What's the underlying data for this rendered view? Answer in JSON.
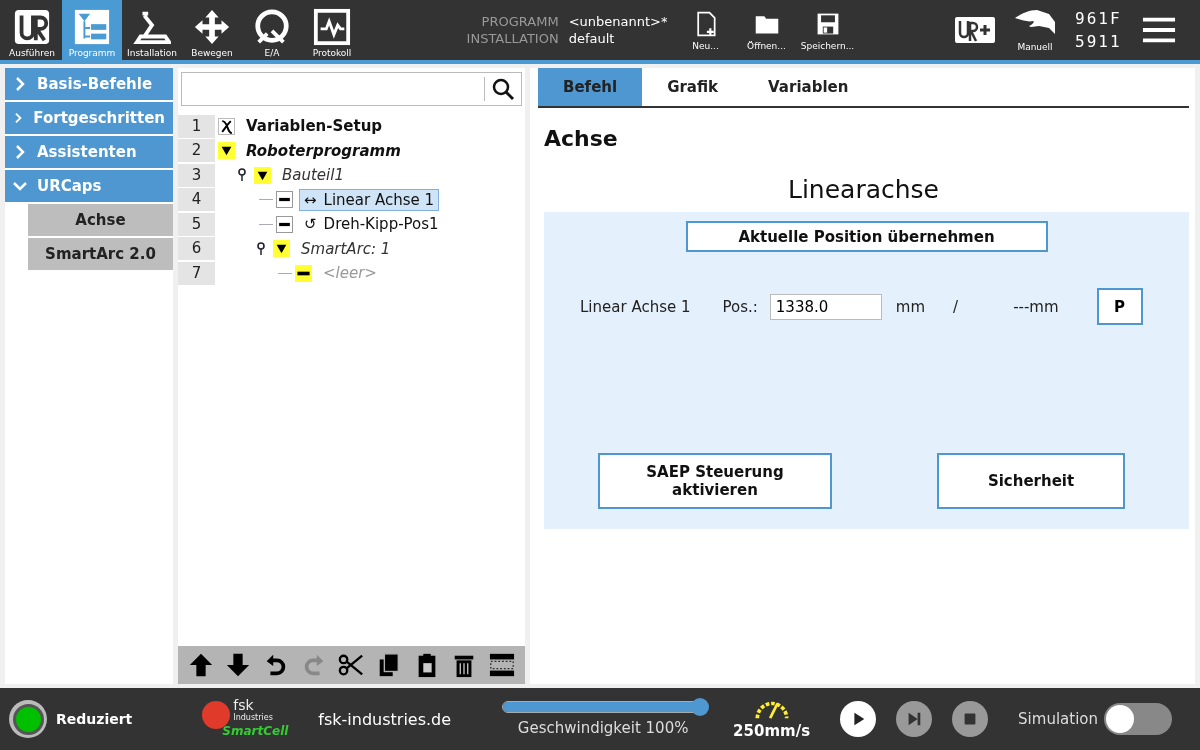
{
  "top_bar": {
    "nav": [
      {
        "kind": "run",
        "label": "Ausführen",
        "selected": false
      },
      {
        "kind": "program",
        "label": "Programm",
        "selected": true
      },
      {
        "kind": "installation",
        "label": "Installation",
        "selected": false
      },
      {
        "kind": "move",
        "label": "Bewegen",
        "selected": false
      },
      {
        "kind": "io",
        "label": "E/A",
        "selected": false
      },
      {
        "kind": "log",
        "label": "Protokoll",
        "selected": false
      }
    ],
    "program_label": "PROGRAMM",
    "program_value": "<unbenannt>*",
    "installation_label": "INSTALLATION",
    "installation_value": "default",
    "file_buttons": [
      {
        "kind": "new",
        "label": "Neu..."
      },
      {
        "kind": "open",
        "label": "Öffnen..."
      },
      {
        "kind": "save",
        "label": "Speichern..."
      }
    ],
    "mode": "Manuell",
    "serial": [
      "961F",
      "5911"
    ]
  },
  "sidebar": {
    "items": [
      {
        "label": "Basis-Befehle",
        "expanded": false
      },
      {
        "label": "Fortgeschritten",
        "expanded": false
      },
      {
        "label": "Assistenten",
        "expanded": false
      },
      {
        "label": "URCaps",
        "expanded": true,
        "children": [
          {
            "label": "Achse"
          },
          {
            "label": "SmartArc 2.0"
          }
        ]
      }
    ]
  },
  "tree": {
    "nodes": [
      {
        "line": "1",
        "kind": "variables",
        "label": "Variablen-Setup",
        "selected": false
      },
      {
        "line": "2",
        "kind": "folder",
        "label": "Roboterprogramm",
        "selected": false,
        "children": [
          {
            "line": "3",
            "kind": "folder",
            "label": "Bauteil1",
            "selected": false,
            "children": [
              {
                "line": "4",
                "kind": "command",
                "symbol": "↔",
                "label": "Linear Achse 1",
                "selected": true
              },
              {
                "line": "5",
                "kind": "command",
                "symbol": "↺",
                "label": "Dreh-Kipp-Pos1",
                "selected": false
              },
              {
                "line": "6",
                "kind": "folder",
                "label": "SmartArc: 1",
                "selected": false,
                "children": [
                  {
                    "line": "7",
                    "kind": "empty",
                    "label": "<leer>",
                    "selected": false
                  }
                ]
              }
            ]
          }
        ]
      }
    ],
    "toolbar": [
      {
        "kind": "up",
        "disabled": false
      },
      {
        "kind": "down",
        "disabled": false
      },
      {
        "kind": "undo",
        "disabled": false
      },
      {
        "kind": "redo",
        "disabled": true
      },
      {
        "kind": "cut",
        "disabled": false
      },
      {
        "kind": "copy",
        "disabled": false
      },
      {
        "kind": "paste",
        "disabled": false
      },
      {
        "kind": "delete",
        "disabled": false
      },
      {
        "kind": "suppress",
        "disabled": false
      }
    ]
  },
  "command_panel": {
    "tabs": [
      {
        "label": "Befehl",
        "selected": true
      },
      {
        "label": "Grafik",
        "selected": false
      },
      {
        "label": "Variablen",
        "selected": false
      }
    ],
    "heading": "Achse",
    "title": "Linearachse",
    "take_position_button": "Aktuelle Position übernehmen",
    "axis": {
      "name": "Linear Achse 1",
      "pos_label": "Pos.:",
      "pos_value": "1338.0",
      "unit": "mm",
      "separator": "/",
      "target": "---mm",
      "p_button": "P"
    },
    "buttons": [
      "SAEP Steuerung aktivieren",
      "Sicherheit"
    ]
  },
  "bottom_bar": {
    "status": "Reduziert",
    "logo": {
      "top": "fsk",
      "middle": "Industries",
      "bottom": "SmartCell"
    },
    "website": "fsk-industries.de",
    "speed_slider": {
      "level": 1.0,
      "label": "Geschwindigkeit 100%"
    },
    "speed": "250mm/s",
    "controls": [
      {
        "kind": "play",
        "disabled": false
      },
      {
        "kind": "step",
        "disabled": true
      },
      {
        "kind": "stop",
        "disabled": true
      }
    ],
    "simulation": {
      "label": "Simulation",
      "on": false
    }
  }
}
